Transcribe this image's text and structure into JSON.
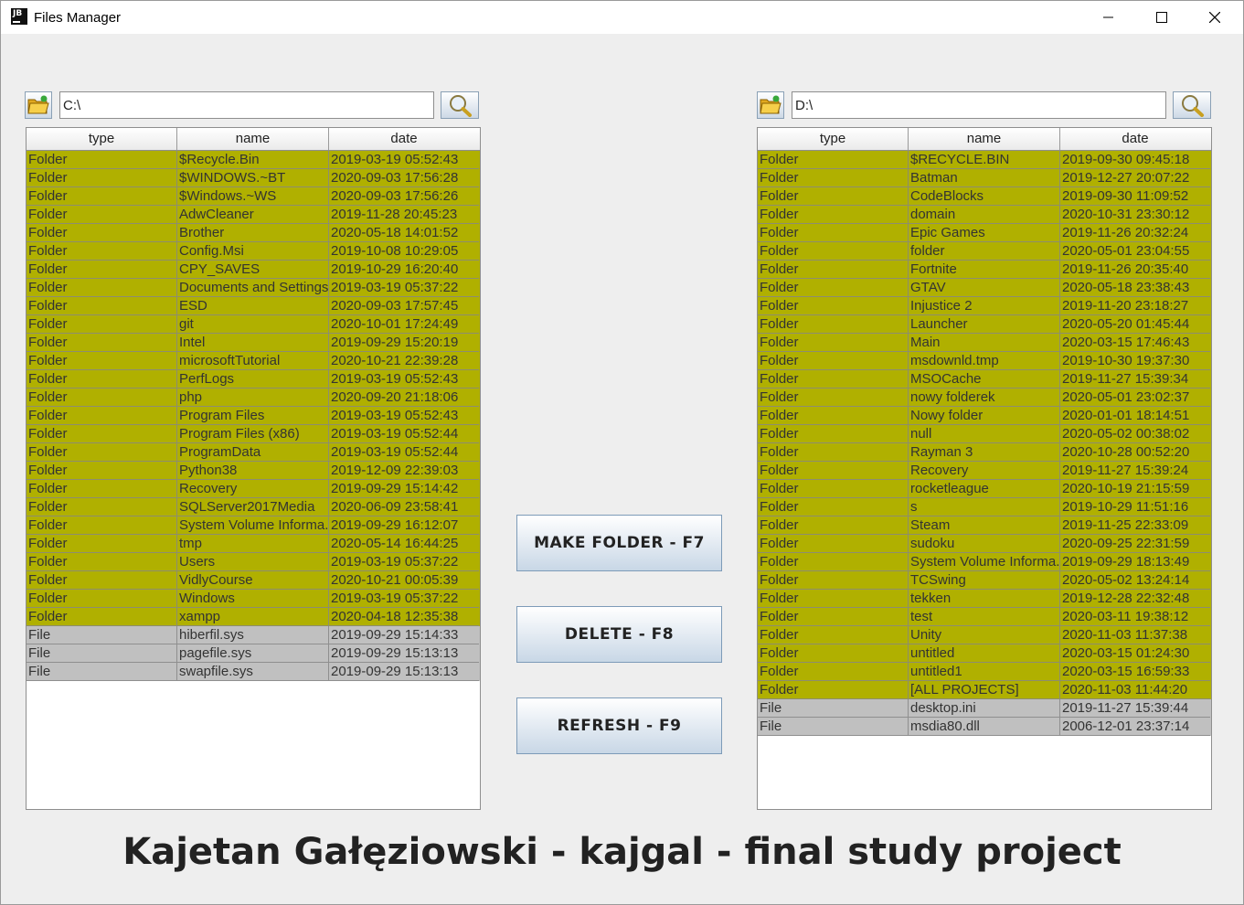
{
  "window": {
    "title": "Files Manager",
    "app_icon_text": "JB"
  },
  "left": {
    "path": "C:\\",
    "headers": [
      "type",
      "name",
      "date"
    ],
    "rows": [
      {
        "type": "Folder",
        "name": "$Recycle.Bin",
        "date": "2019-03-19 05:52:43"
      },
      {
        "type": "Folder",
        "name": "$WINDOWS.~BT",
        "date": "2020-09-03 17:56:28"
      },
      {
        "type": "Folder",
        "name": "$Windows.~WS",
        "date": "2020-09-03 17:56:26"
      },
      {
        "type": "Folder",
        "name": "AdwCleaner",
        "date": "2019-11-28 20:45:23"
      },
      {
        "type": "Folder",
        "name": "Brother",
        "date": "2020-05-18 14:01:52"
      },
      {
        "type": "Folder",
        "name": "Config.Msi",
        "date": "2019-10-08 10:29:05"
      },
      {
        "type": "Folder",
        "name": "CPY_SAVES",
        "date": "2019-10-29 16:20:40"
      },
      {
        "type": "Folder",
        "name": "Documents and Settings",
        "date": "2019-03-19 05:37:22"
      },
      {
        "type": "Folder",
        "name": "ESD",
        "date": "2020-09-03 17:57:45"
      },
      {
        "type": "Folder",
        "name": "git",
        "date": "2020-10-01 17:24:49"
      },
      {
        "type": "Folder",
        "name": "Intel",
        "date": "2019-09-29 15:20:19"
      },
      {
        "type": "Folder",
        "name": "microsoftTutorial",
        "date": "2020-10-21 22:39:28"
      },
      {
        "type": "Folder",
        "name": "PerfLogs",
        "date": "2019-03-19 05:52:43"
      },
      {
        "type": "Folder",
        "name": "php",
        "date": "2020-09-20 21:18:06"
      },
      {
        "type": "Folder",
        "name": "Program Files",
        "date": "2019-03-19 05:52:43"
      },
      {
        "type": "Folder",
        "name": "Program Files (x86)",
        "date": "2019-03-19 05:52:44"
      },
      {
        "type": "Folder",
        "name": "ProgramData",
        "date": "2019-03-19 05:52:44"
      },
      {
        "type": "Folder",
        "name": "Python38",
        "date": "2019-12-09 22:39:03"
      },
      {
        "type": "Folder",
        "name": "Recovery",
        "date": "2019-09-29 15:14:42"
      },
      {
        "type": "Folder",
        "name": "SQLServer2017Media",
        "date": "2020-06-09 23:58:41"
      },
      {
        "type": "Folder",
        "name": "System Volume Informa...",
        "date": "2019-09-29 16:12:07"
      },
      {
        "type": "Folder",
        "name": "tmp",
        "date": "2020-05-14 16:44:25"
      },
      {
        "type": "Folder",
        "name": "Users",
        "date": "2019-03-19 05:37:22"
      },
      {
        "type": "Folder",
        "name": "VidlyCourse",
        "date": "2020-10-21 00:05:39"
      },
      {
        "type": "Folder",
        "name": "Windows",
        "date": "2019-03-19 05:37:22"
      },
      {
        "type": "Folder",
        "name": "xampp",
        "date": "2020-04-18 12:35:38"
      },
      {
        "type": "File",
        "name": "hiberfil.sys",
        "date": "2019-09-29 15:14:33"
      },
      {
        "type": "File",
        "name": "pagefile.sys",
        "date": "2019-09-29 15:13:13"
      },
      {
        "type": "File",
        "name": "swapfile.sys",
        "date": "2019-09-29 15:13:13"
      }
    ]
  },
  "right": {
    "path": "D:\\",
    "headers": [
      "type",
      "name",
      "date"
    ],
    "rows": [
      {
        "type": "Folder",
        "name": "$RECYCLE.BIN",
        "date": "2019-09-30 09:45:18"
      },
      {
        "type": "Folder",
        "name": "Batman",
        "date": "2019-12-27 20:07:22"
      },
      {
        "type": "Folder",
        "name": "CodeBlocks",
        "date": "2019-09-30 11:09:52"
      },
      {
        "type": "Folder",
        "name": "domain",
        "date": "2020-10-31 23:30:12"
      },
      {
        "type": "Folder",
        "name": "Epic Games",
        "date": "2019-11-26 20:32:24"
      },
      {
        "type": "Folder",
        "name": "folder",
        "date": "2020-05-01 23:04:55"
      },
      {
        "type": "Folder",
        "name": "Fortnite",
        "date": "2019-11-26 20:35:40"
      },
      {
        "type": "Folder",
        "name": "GTAV",
        "date": "2020-05-18 23:38:43"
      },
      {
        "type": "Folder",
        "name": "Injustice 2",
        "date": "2019-11-20 23:18:27"
      },
      {
        "type": "Folder",
        "name": "Launcher",
        "date": "2020-05-20 01:45:44"
      },
      {
        "type": "Folder",
        "name": "Main",
        "date": "2020-03-15 17:46:43"
      },
      {
        "type": "Folder",
        "name": "msdownld.tmp",
        "date": "2019-10-30 19:37:30"
      },
      {
        "type": "Folder",
        "name": "MSOCache",
        "date": "2019-11-27 15:39:34"
      },
      {
        "type": "Folder",
        "name": "nowy  folderek",
        "date": "2020-05-01 23:02:37"
      },
      {
        "type": "Folder",
        "name": "Nowy folder",
        "date": "2020-01-01 18:14:51"
      },
      {
        "type": "Folder",
        "name": "null",
        "date": "2020-05-02 00:38:02"
      },
      {
        "type": "Folder",
        "name": "Rayman 3",
        "date": "2020-10-28 00:52:20"
      },
      {
        "type": "Folder",
        "name": "Recovery",
        "date": "2019-11-27 15:39:24"
      },
      {
        "type": "Folder",
        "name": "rocketleague",
        "date": "2020-10-19 21:15:59"
      },
      {
        "type": "Folder",
        "name": "s",
        "date": "2019-10-29 11:51:16"
      },
      {
        "type": "Folder",
        "name": "Steam",
        "date": "2019-11-25 22:33:09"
      },
      {
        "type": "Folder",
        "name": "sudoku",
        "date": "2020-09-25 22:31:59"
      },
      {
        "type": "Folder",
        "name": "System Volume Informa...",
        "date": "2019-09-29 18:13:49"
      },
      {
        "type": "Folder",
        "name": "TCSwing",
        "date": "2020-05-02 13:24:14"
      },
      {
        "type": "Folder",
        "name": "tekken",
        "date": "2019-12-28 22:32:48"
      },
      {
        "type": "Folder",
        "name": "test",
        "date": "2020-03-11 19:38:12"
      },
      {
        "type": "Folder",
        "name": "Unity",
        "date": "2020-11-03 11:37:38"
      },
      {
        "type": "Folder",
        "name": "untitled",
        "date": "2020-03-15 01:24:30"
      },
      {
        "type": "Folder",
        "name": "untitled1",
        "date": "2020-03-15 16:59:33"
      },
      {
        "type": "Folder",
        "name": "[ALL PROJECTS]",
        "date": "2020-11-03 11:44:20"
      },
      {
        "type": "File",
        "name": "desktop.ini",
        "date": "2019-11-27 15:39:44"
      },
      {
        "type": "File",
        "name": "msdia80.dll",
        "date": "2006-12-01 23:37:14"
      }
    ]
  },
  "actions": {
    "make_folder": "MAKE FOLDER - F7",
    "delete": "DELETE - F8",
    "refresh": "REFRESH - F9"
  },
  "footer": "Kajetan Gałęziowski - kajgal - final study project",
  "colors": {
    "folder_row": "#b0b000",
    "file_row": "#c0c0c0",
    "window_bg": "#eeeeee"
  },
  "icons": {
    "open_folder": "folder-open-icon",
    "search": "magnifier-icon",
    "minimize": "minimize-icon",
    "maximize": "maximize-icon",
    "close": "close-icon"
  }
}
